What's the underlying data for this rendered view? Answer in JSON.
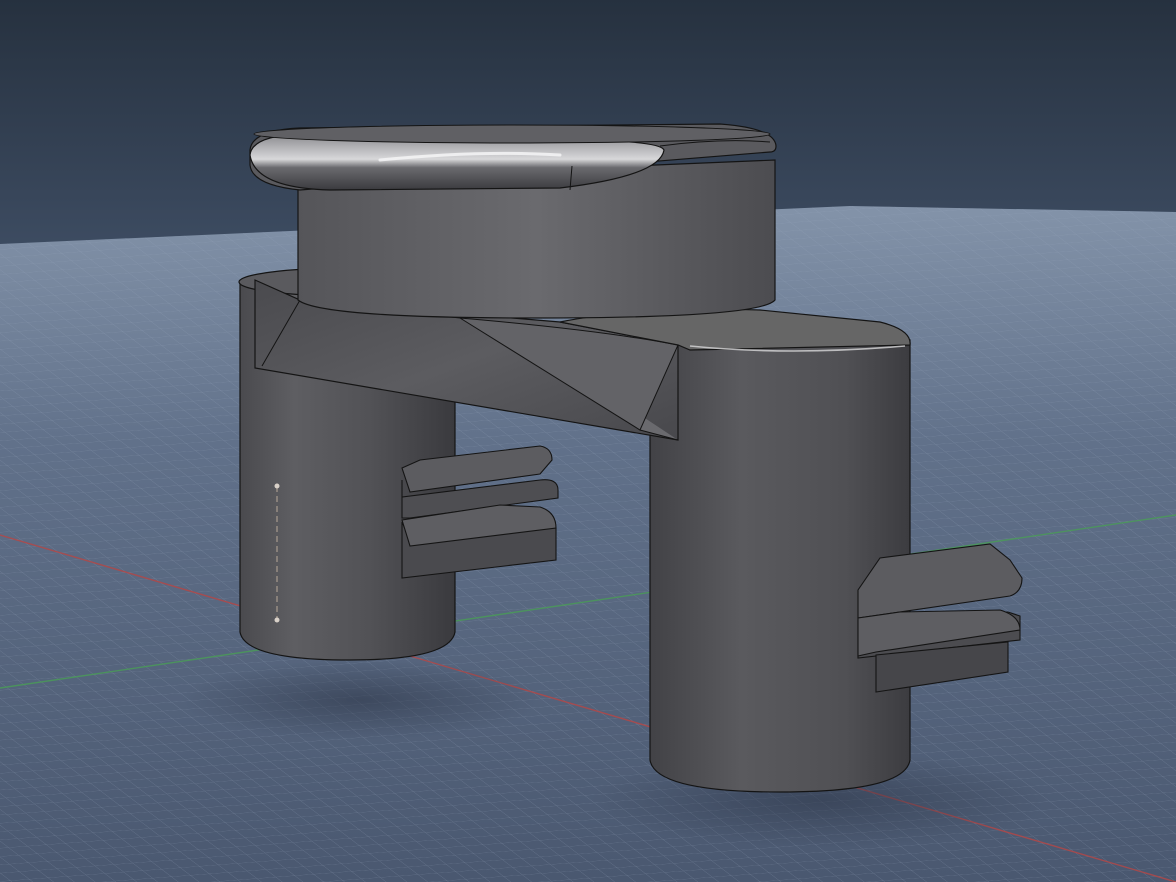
{
  "viewport": {
    "colors": {
      "sky_top": "#2a3546",
      "sky_bottom": "#3c4c63",
      "ground": "#55657d",
      "grid_minor": "#7f90a8",
      "grid_major": "#9dadc2",
      "axis_x": "#b04a4a",
      "axis_y": "#4a9a58",
      "body_dark": "#3e3e42",
      "body_mid": "#58585c",
      "body_light": "#7a7a7e",
      "edge": "#141414",
      "highlight": "#e8e8ea"
    }
  }
}
